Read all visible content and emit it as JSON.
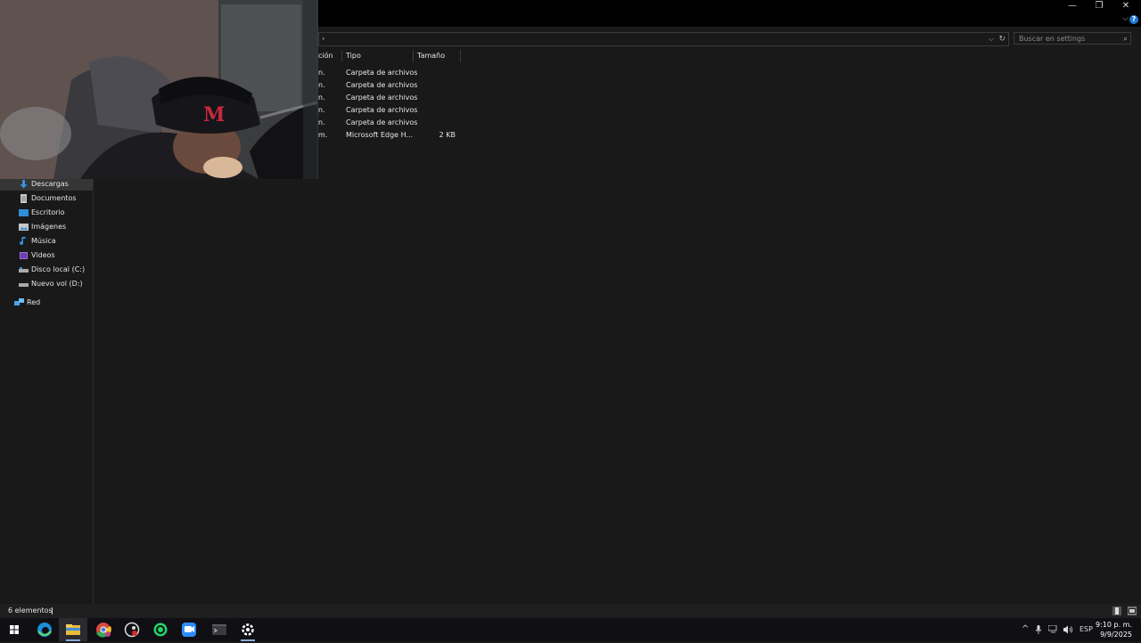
{
  "window": {
    "minimize": "—",
    "restore": "❐",
    "close": "✕",
    "help": "?"
  },
  "address": {
    "chevron": "›",
    "dropdown": "⌵",
    "refresh": "↻"
  },
  "search": {
    "placeholder": "Buscar en settings",
    "icon": "⌕"
  },
  "sidebar": {
    "items": [
      {
        "label": "Descargas",
        "icon": "download-icon",
        "color": "#3b8fe0"
      },
      {
        "label": "Documentos",
        "icon": "document-icon",
        "color": "#c8c8c8"
      },
      {
        "label": "Escritorio",
        "icon": "desktop-icon",
        "color": "#2e8fd6"
      },
      {
        "label": "Imágenes",
        "icon": "pictures-icon",
        "color": "#c8c8c8"
      },
      {
        "label": "Música",
        "icon": "music-icon",
        "color": "#3b8fe0"
      },
      {
        "label": "Videos",
        "icon": "video-icon",
        "color": "#9b6bd6"
      },
      {
        "label": "Disco local (C:)",
        "icon": "drive-icon",
        "color": "#aaaaaa"
      },
      {
        "label": "Nuevo vol (D:)",
        "icon": "drive-icon",
        "color": "#aaaaaa"
      }
    ],
    "network": {
      "label": "Red",
      "icon": "network-icon",
      "color": "#4aa3e8"
    }
  },
  "columns": {
    "date_partial": "ción",
    "type": "Tipo",
    "size": "Tamaño"
  },
  "rows": [
    {
      "date_partial": "n.",
      "type": "Carpeta de archivos",
      "size": ""
    },
    {
      "date_partial": "n.",
      "type": "Carpeta de archivos",
      "size": ""
    },
    {
      "date_partial": "n.",
      "type": "Carpeta de archivos",
      "size": ""
    },
    {
      "date_partial": "n.",
      "type": "Carpeta de archivos",
      "size": ""
    },
    {
      "date_partial": "n.",
      "type": "Carpeta de archivos",
      "size": ""
    },
    {
      "date_partial": "m.",
      "type": "Microsoft Edge H...",
      "size": "2 KB"
    }
  ],
  "status": {
    "count": "6 elementos"
  },
  "taskbar": {
    "apps": [
      "start-icon",
      "edge-icon",
      "file-explorer-icon",
      "chrome-icon",
      "steam-icon",
      "whatsapp-icon",
      "zoom-icon",
      "terminal-icon",
      "settings-icon"
    ],
    "tray": {
      "chevron": "^",
      "language": "ESP"
    },
    "clock": {
      "time": "9:10 p. m.",
      "date": "9/9/2025"
    }
  }
}
